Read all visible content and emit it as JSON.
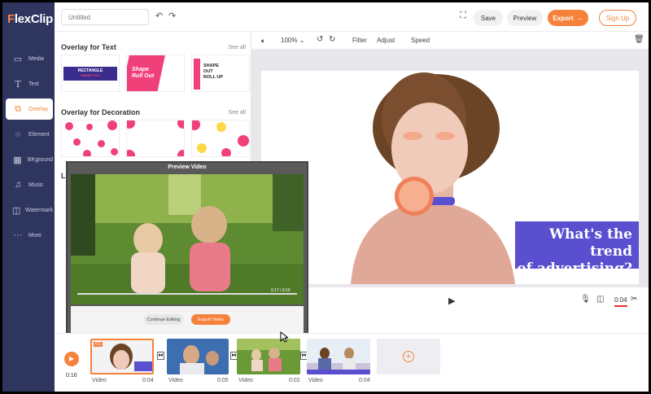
{
  "brand": {
    "logo_first": "F",
    "logo_rest": "lexClip"
  },
  "sidebar": {
    "items": [
      {
        "label": "Media",
        "icon": "media-icon"
      },
      {
        "label": "Text",
        "icon": "text-icon"
      },
      {
        "label": "Overlay",
        "icon": "overlay-icon"
      },
      {
        "label": "Element",
        "icon": "element-icon"
      },
      {
        "label": "BKground",
        "icon": "background-icon"
      },
      {
        "label": "Music",
        "icon": "music-icon"
      },
      {
        "label": "Watermark",
        "icon": "watermark-icon"
      },
      {
        "label": "More",
        "icon": "more-icon"
      }
    ]
  },
  "topbar": {
    "title_placeholder": "Untitled",
    "save_label": "Save",
    "preview_label": "Preview",
    "export_label": "Export",
    "signup_label": "Sign Up"
  },
  "toolbar": {
    "zoom": "100%",
    "filter_label": "Filter",
    "adjust_label": "Adjust",
    "speed_label": "Speed"
  },
  "panel": {
    "section_text": "Overlay for Text",
    "section_decoration": "Overlay for Decoration",
    "see_all": "See all",
    "obscured_label": "Lo",
    "text_thumbs": [
      {
        "line1": "RECTANGLE",
        "line2": "SWEEP OUT"
      },
      {
        "line1": "Shape",
        "line2": "Roll Out"
      },
      {
        "line1": "SHAPE",
        "line2": "OUT",
        "line3": "ROLL UP"
      }
    ]
  },
  "canvas": {
    "headline_line1": "What's the trend",
    "headline_line2": "of advertising?"
  },
  "playbar": {
    "time": "0:04"
  },
  "preview_modal": {
    "title": "Preview Video",
    "time": "0:17 / 0:16",
    "continue_label": "Continue Editing",
    "export_label": "Export Video",
    "hidden_tabs": [
      "Speed",
      "Adjust",
      "Filter"
    ]
  },
  "timeline": {
    "total_time": "0:16",
    "clips": [
      {
        "badge": "01",
        "label": "Video",
        "duration": "0:04"
      },
      {
        "badge": "",
        "label": "Video",
        "duration": "0:05"
      },
      {
        "badge": "",
        "label": "Video",
        "duration": "0:02"
      },
      {
        "badge": "",
        "label": "Video",
        "duration": "0:04"
      }
    ],
    "add_label": "+"
  },
  "colors": {
    "accent": "#f5813b",
    "sidebar": "#2e3660",
    "headline_box": "#5a4fcf",
    "pink": "#f0407a"
  }
}
